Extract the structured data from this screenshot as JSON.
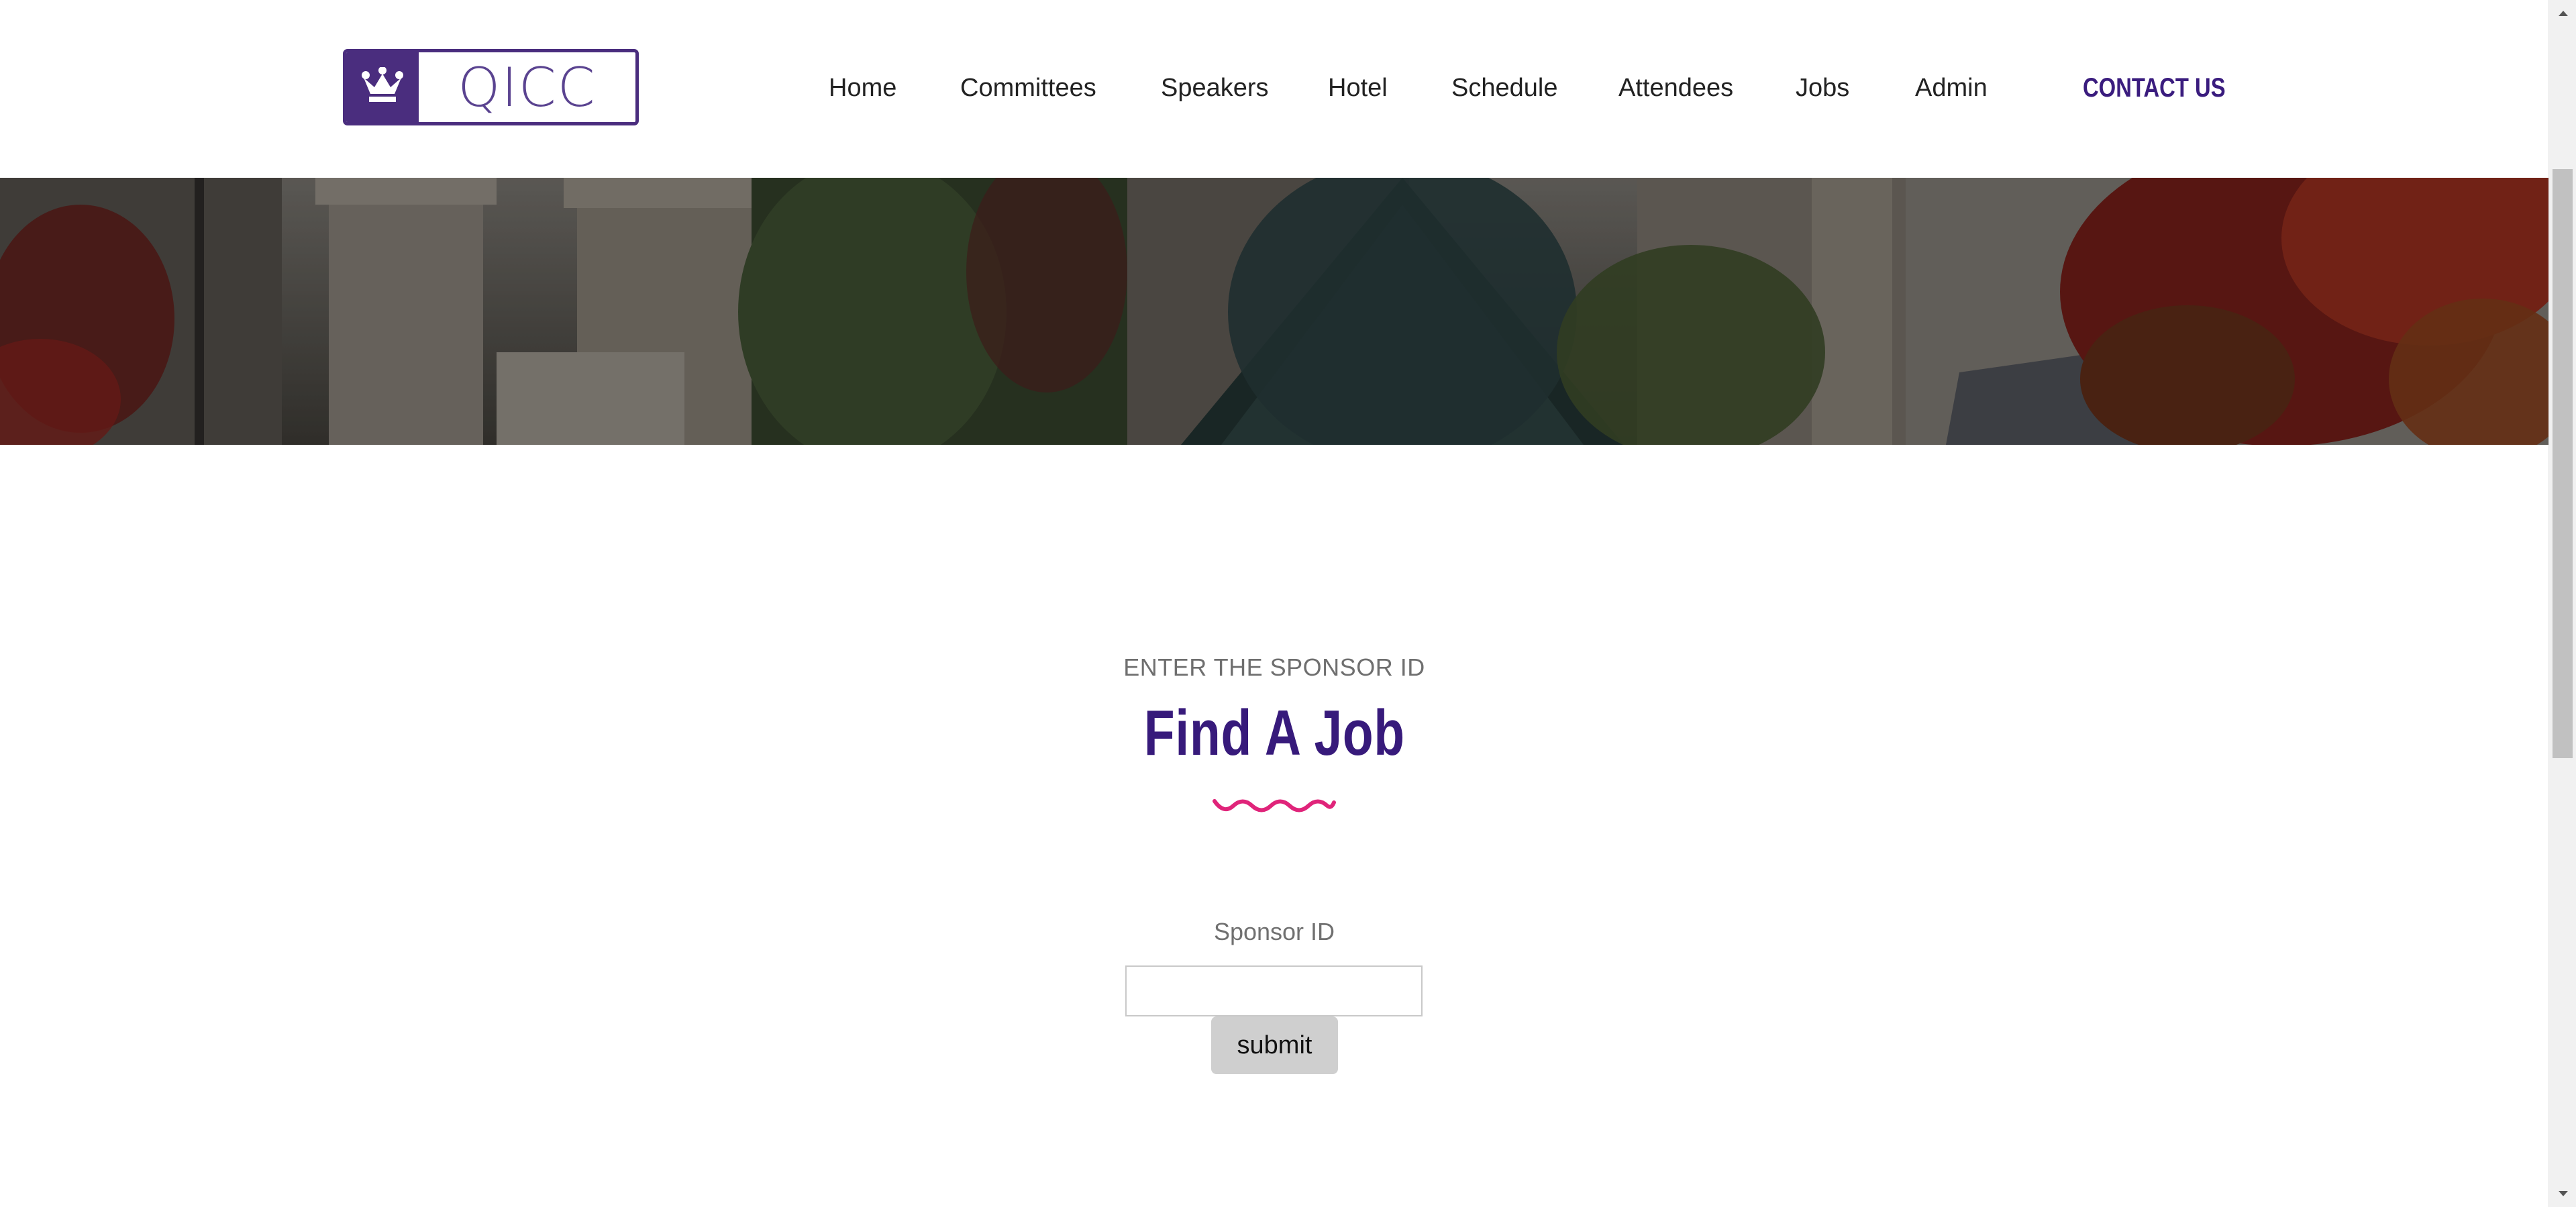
{
  "header": {
    "logo_text": "QICC",
    "nav": [
      {
        "label": "Home"
      },
      {
        "label": "Committees"
      },
      {
        "label": "Speakers"
      },
      {
        "label": "Hotel"
      },
      {
        "label": "Schedule"
      },
      {
        "label": "Attendees"
      },
      {
        "label": "Jobs"
      },
      {
        "label": "Admin"
      }
    ],
    "contact_label": "CONTACT US"
  },
  "main": {
    "pretitle": "ENTER THE SPONSOR ID",
    "title": "Find A Job",
    "form": {
      "label": "Sponsor ID",
      "input_value": "",
      "submit_label": "submit"
    }
  },
  "colors": {
    "brand": "#4a2d7e",
    "title": "#371a7b",
    "accent_squiggle": "#e0247a"
  },
  "icons": {
    "logo_mark": "crown-icon",
    "decor": "squiggle-divider-icon",
    "scroll_up": "scroll-up-arrow-icon",
    "scroll_down": "scroll-down-arrow-icon"
  }
}
